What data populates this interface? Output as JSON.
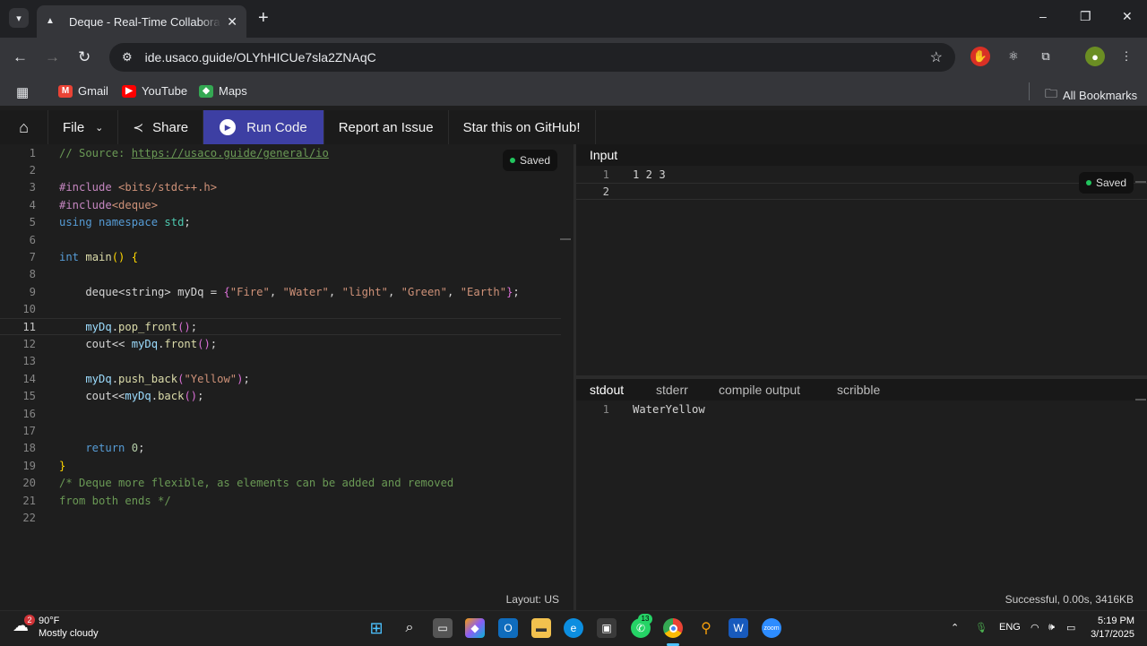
{
  "browser": {
    "tab_title": "Deque - Real-Time Collaborative Online IDE",
    "tab_close": "✕",
    "new_tab": "+",
    "url": "ide.usaco.guide/OLYhHICUe7sla2ZNAqC",
    "window_controls": [
      "–",
      "❐",
      "✕"
    ],
    "bookmarks": [
      {
        "label": "Gmail",
        "icon": "gmail-icon",
        "color": "#ea4335"
      },
      {
        "label": "YouTube",
        "icon": "youtube-icon",
        "color": "#ff0000"
      },
      {
        "label": "Maps",
        "icon": "maps-icon",
        "color": "#34a853"
      }
    ],
    "all_bookmarks": "All Bookmarks"
  },
  "appnav": {
    "file": "File",
    "share": "Share",
    "run": "Run Code",
    "report": "Report an Issue",
    "star": "Star this on GitHub!"
  },
  "editor": {
    "saved": "Saved",
    "layout": "Layout: US",
    "current_line": 11,
    "lines": [
      [
        {
          "t": "// Source: ",
          "c": "c-com"
        },
        {
          "t": "https://usaco.guide/general/io",
          "c": "c-com c-url"
        }
      ],
      [],
      [
        {
          "t": "#include ",
          "c": "c-pre"
        },
        {
          "t": "<bits/stdc++.h>",
          "c": "c-str"
        }
      ],
      [
        {
          "t": "#include",
          "c": "c-pre"
        },
        {
          "t": "<deque>",
          "c": "c-str"
        }
      ],
      [
        {
          "t": "using ",
          "c": "c-kw"
        },
        {
          "t": "namespace ",
          "c": "c-kw"
        },
        {
          "t": "std",
          "c": "c-type"
        },
        {
          "t": ";",
          "c": ""
        }
      ],
      [],
      [
        {
          "t": "int ",
          "c": "c-kw"
        },
        {
          "t": "main",
          "c": "c-fn"
        },
        {
          "t": "() ",
          "c": "c-br"
        },
        {
          "t": "{",
          "c": "c-br"
        }
      ],
      [],
      [
        {
          "t": "    deque<string> myDq = ",
          "c": ""
        },
        {
          "t": "{",
          "c": "c-br2"
        },
        {
          "t": "\"Fire\"",
          "c": "c-str"
        },
        {
          "t": ", ",
          "c": ""
        },
        {
          "t": "\"Water\"",
          "c": "c-str"
        },
        {
          "t": ", ",
          "c": ""
        },
        {
          "t": "\"light\"",
          "c": "c-str"
        },
        {
          "t": ", ",
          "c": ""
        },
        {
          "t": "\"Green\"",
          "c": "c-str"
        },
        {
          "t": ", ",
          "c": ""
        },
        {
          "t": "\"Earth\"",
          "c": "c-str"
        },
        {
          "t": "}",
          "c": "c-br2"
        },
        {
          "t": ";",
          "c": ""
        }
      ],
      [],
      [
        {
          "t": "    myDq",
          "c": "c-var"
        },
        {
          "t": ".",
          "c": ""
        },
        {
          "t": "pop_front",
          "c": "c-fn"
        },
        {
          "t": "()",
          "c": "c-br2"
        },
        {
          "t": ";",
          "c": ""
        }
      ],
      [
        {
          "t": "    cout<< ",
          "c": ""
        },
        {
          "t": "myDq",
          "c": "c-var"
        },
        {
          "t": ".",
          "c": ""
        },
        {
          "t": "front",
          "c": "c-fn"
        },
        {
          "t": "()",
          "c": "c-br2"
        },
        {
          "t": ";",
          "c": ""
        }
      ],
      [],
      [
        {
          "t": "    myDq",
          "c": "c-var"
        },
        {
          "t": ".",
          "c": ""
        },
        {
          "t": "push_back",
          "c": "c-fn"
        },
        {
          "t": "(",
          "c": "c-br2"
        },
        {
          "t": "\"Yellow\"",
          "c": "c-str"
        },
        {
          "t": ")",
          "c": "c-br2"
        },
        {
          "t": ";",
          "c": ""
        }
      ],
      [
        {
          "t": "    cout<<",
          "c": ""
        },
        {
          "t": "myDq",
          "c": "c-var"
        },
        {
          "t": ".",
          "c": ""
        },
        {
          "t": "back",
          "c": "c-fn"
        },
        {
          "t": "()",
          "c": "c-br2"
        },
        {
          "t": ";",
          "c": ""
        }
      ],
      [],
      [],
      [
        {
          "t": "    return ",
          "c": "c-kw"
        },
        {
          "t": "0",
          "c": "c-num"
        },
        {
          "t": ";",
          "c": ""
        }
      ],
      [
        {
          "t": "}",
          "c": "c-br"
        }
      ],
      [
        {
          "t": "/* Deque more flexible, as elements can be added and removed",
          "c": "c-com"
        }
      ],
      [
        {
          "t": "from both ends */",
          "c": "c-com"
        }
      ],
      []
    ]
  },
  "input_pane": {
    "tab": "Input",
    "saved": "Saved",
    "lines": [
      "1 2 3",
      ""
    ]
  },
  "output_pane": {
    "tabs": [
      "stdout",
      "stderr",
      "compile output",
      "scribble"
    ],
    "active_tab": "stdout",
    "lines": [
      "WaterYellow"
    ],
    "status": "Successful, 0.00s, 3416KB"
  },
  "taskbar": {
    "weather_temp": "90°F",
    "weather_desc": "Mostly cloudy",
    "weather_badge": "2",
    "whatsapp_badge": "13",
    "lang": "ENG",
    "time": "5:19 PM",
    "date": "3/17/2025"
  },
  "colors": {
    "accent": "#3d3fa3",
    "saved_dot": "#22c55e"
  }
}
